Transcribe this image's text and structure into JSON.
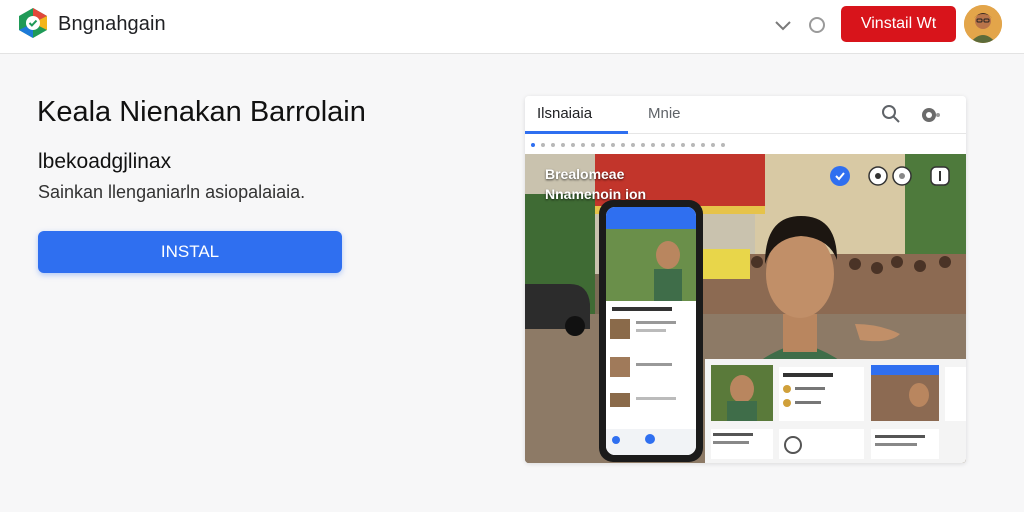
{
  "header": {
    "brand": "Bngnahgain",
    "cta_label": "Vinstail Wt"
  },
  "hero": {
    "title": "Keala Nienakan Barrolain",
    "subtitle": "lbekoadgjlinax",
    "description": "Sainkan llenganiarln asiopalaiaia.",
    "install_label": "INSTAL"
  },
  "preview": {
    "tabs": [
      "Ilsnaiaia",
      "Mnie"
    ],
    "overlay_line1": "Brealomeae",
    "overlay_line2": "Nnamenoin ion"
  },
  "colors": {
    "accent_blue": "#2f6ff0",
    "brand_red": "#d8141b"
  },
  "icons": {
    "logo": "app-logo-icon",
    "dropdown": "chevron-down-icon",
    "status": "circle-icon",
    "search": "search-icon",
    "more": "more-icon",
    "avatar": "user-avatar"
  }
}
